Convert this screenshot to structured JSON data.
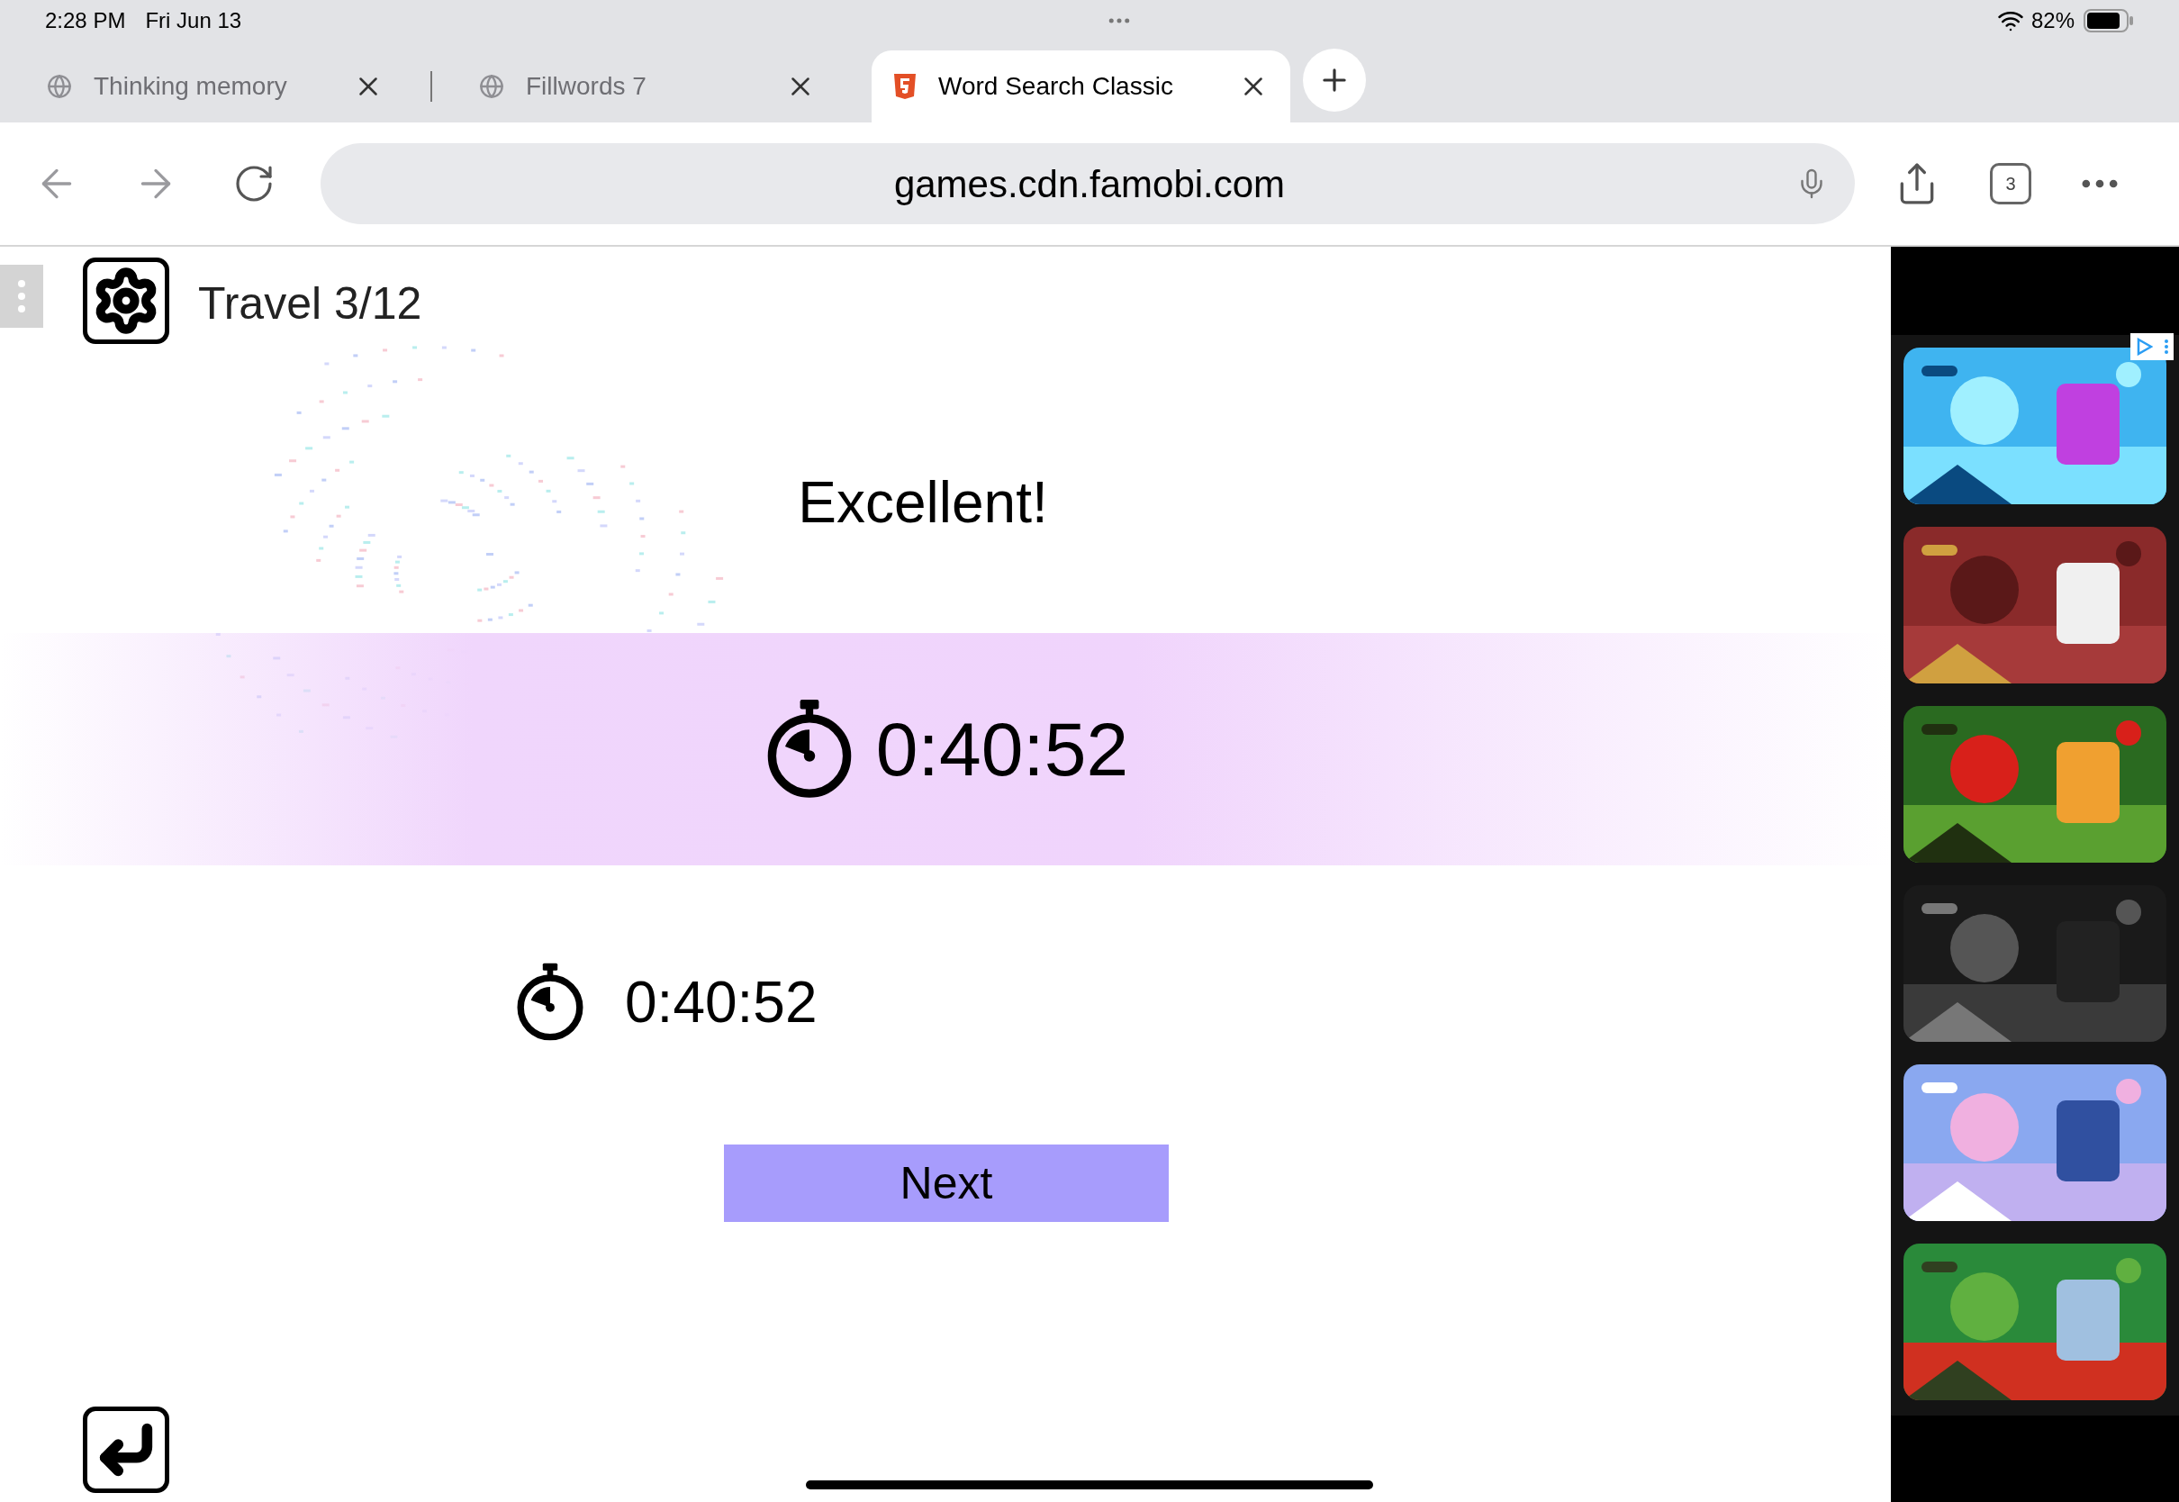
{
  "status_bar": {
    "time": "2:28 PM",
    "date": "Fri Jun 13",
    "battery": "82%"
  },
  "tabs": [
    {
      "title": "Thinking memory",
      "kind": "globe",
      "selected": false
    },
    {
      "title": "Fillwords 7",
      "kind": "globe",
      "selected": false
    },
    {
      "title": "Word Search Classic",
      "kind": "html5",
      "selected": true
    }
  ],
  "address_bar": {
    "url": "games.cdn.famobi.com"
  },
  "tab_count": "3",
  "game": {
    "level_title": "Travel 3/12",
    "message": "Excellent!",
    "time_main": "0:40:52",
    "time_best": "0:40:52",
    "next_button": "Next"
  }
}
